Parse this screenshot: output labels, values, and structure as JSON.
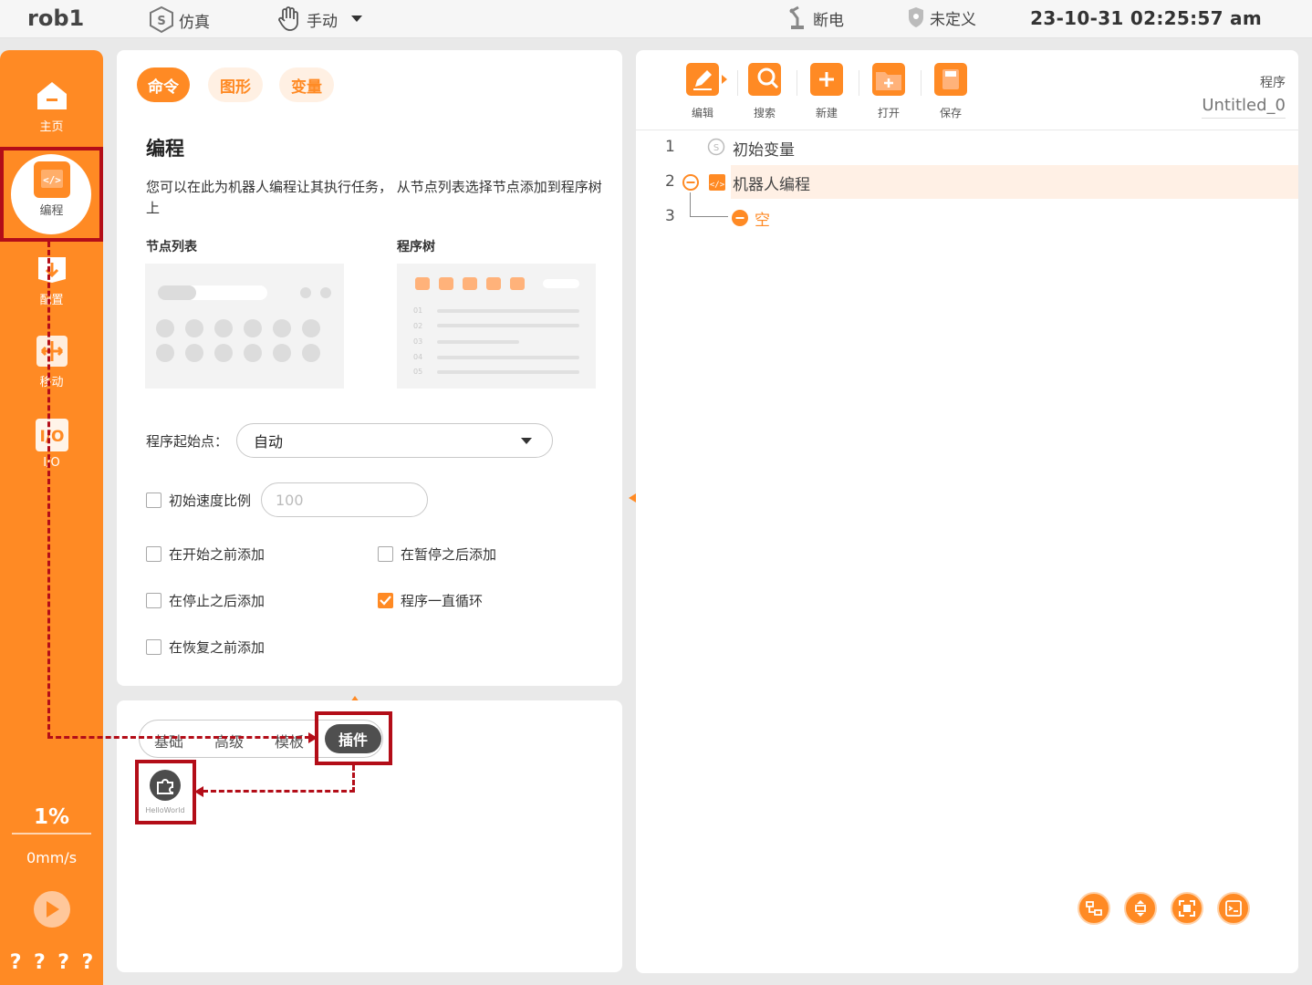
{
  "topbar": {
    "robot_name": "rob1",
    "mode_sim": "仿真",
    "mode_manual": "手动",
    "power": "断电",
    "safety": "未定义",
    "datetime": "23-10-31 02:25:57 am"
  },
  "sidebar": {
    "items": [
      {
        "label": "主页",
        "icon": "home-icon"
      },
      {
        "label": "编程",
        "icon": "code-icon"
      },
      {
        "label": "配置",
        "icon": "config-icon"
      },
      {
        "label": "移动",
        "icon": "move-icon"
      },
      {
        "label": "I/O",
        "icon": "io-icon"
      }
    ],
    "speed_percent": "1%",
    "speed_mm": "0mm/s",
    "help": [
      "?",
      "?",
      "?",
      "?"
    ]
  },
  "main": {
    "tabs": [
      "命令",
      "图形",
      "变量"
    ],
    "title": "编程",
    "description": "您可以在此为机器人编程让其执行任务， 从节点列表选择节点添加到程序树上",
    "node_list_label": "节点列表",
    "program_tree_label": "程序树",
    "illus_line_numbers": [
      "01",
      "02",
      "03",
      "04",
      "05",
      "06"
    ],
    "start_point_label": "程序起始点：",
    "start_point_value": "自动",
    "init_speed_label": "初始速度比例",
    "init_speed_placeholder": "100",
    "checkboxes": [
      {
        "label": "在开始之前添加",
        "checked": false
      },
      {
        "label": "在暂停之后添加",
        "checked": false
      },
      {
        "label": "在停止之后添加",
        "checked": false
      },
      {
        "label": "程序一直循环",
        "checked": true
      },
      {
        "label": "在恢复之前添加",
        "checked": false
      }
    ]
  },
  "nodes": {
    "tabs": [
      "基础",
      "高级",
      "模板",
      "插件"
    ],
    "active_tab": "插件",
    "plugin_name": "HelloWorld"
  },
  "right": {
    "toolbar": [
      "编辑",
      "搜索",
      "新建",
      "打开",
      "保存"
    ],
    "program_label": "程序",
    "program_name": "Untitled_0",
    "tree": [
      {
        "num": "1",
        "text": "初始变量"
      },
      {
        "num": "2",
        "text": "机器人编程"
      },
      {
        "num": "3",
        "text": "空"
      }
    ]
  },
  "colors": {
    "accent": "#ff8a24",
    "accent_light": "#fff0e3",
    "annotation_red": "#b30d18"
  }
}
